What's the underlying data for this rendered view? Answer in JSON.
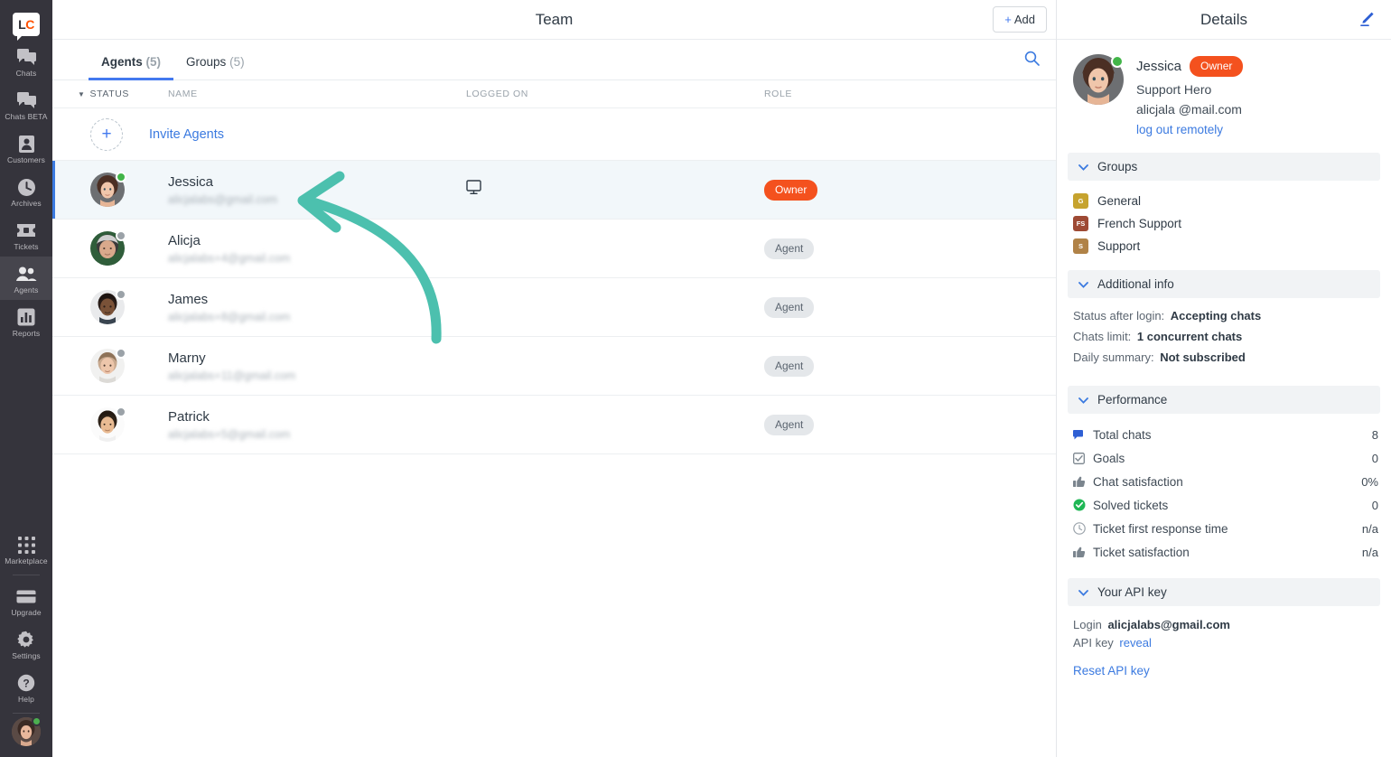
{
  "nav": {
    "logo": "LC",
    "items": [
      {
        "label": "Chats",
        "icon": "chats-icon",
        "active": false
      },
      {
        "label": "Chats BETA",
        "icon": "chats-beta-icon",
        "active": false
      },
      {
        "label": "Customers",
        "icon": "customers-icon",
        "active": false
      },
      {
        "label": "Archives",
        "icon": "archives-clock-icon",
        "active": false
      },
      {
        "label": "Tickets",
        "icon": "ticket-icon",
        "active": false
      },
      {
        "label": "Agents",
        "icon": "agents-people-icon",
        "active": true
      },
      {
        "label": "Reports",
        "icon": "reports-bars-icon",
        "active": false
      }
    ],
    "bottom_items": [
      {
        "label": "Marketplace",
        "icon": "marketplace-grid-icon"
      },
      {
        "label": "Upgrade",
        "icon": "upgrade-card-icon"
      },
      {
        "label": "Settings",
        "icon": "settings-gear-icon"
      },
      {
        "label": "Help",
        "icon": "help-question-icon"
      }
    ]
  },
  "header": {
    "title": "Team",
    "add_label": "Add",
    "add_plus": "+"
  },
  "tabs": [
    {
      "label": "Agents",
      "count": "(5)",
      "active": true
    },
    {
      "label": "Groups",
      "count": "(5)",
      "active": false
    }
  ],
  "list_header": {
    "status": "STATUS",
    "name": "NAME",
    "logged_on": "LOGGED ON",
    "role": "ROLE",
    "sort_caret": "▼"
  },
  "invite": {
    "label": "Invite Agents",
    "plus": "+"
  },
  "agents": [
    {
      "name": "Jessica",
      "email": "alicjalabs@gmail.com",
      "status": "online",
      "role": "Owner",
      "role_type": "owner",
      "logged_on": "desktop",
      "selected": true
    },
    {
      "name": "Alicja",
      "email": "alicjalabs+4@gmail.com",
      "status": "offline",
      "role": "Agent",
      "role_type": "agent",
      "logged_on": "",
      "selected": false
    },
    {
      "name": "James",
      "email": "alicjalabs+8@gmail.com",
      "status": "offline",
      "role": "Agent",
      "role_type": "agent",
      "logged_on": "",
      "selected": false
    },
    {
      "name": "Marny",
      "email": "alicjalabs+11@gmail.com",
      "status": "offline",
      "role": "Agent",
      "role_type": "agent",
      "logged_on": "",
      "selected": false
    },
    {
      "name": "Patrick",
      "email": "alicjalabs+5@gmail.com",
      "status": "offline",
      "role": "Agent",
      "role_type": "agent",
      "logged_on": "",
      "selected": false
    }
  ],
  "details": {
    "title": "Details",
    "profile": {
      "name": "Jessica",
      "badge": "Owner",
      "subtitle": "Support Hero",
      "email": "alicjala @mail.com",
      "logout_link": "log out remotely",
      "status": "online"
    },
    "groups_section": {
      "title": "Groups",
      "chevron": "⌄"
    },
    "groups": [
      {
        "initials": "G",
        "name": "General",
        "color": "#c6a32e"
      },
      {
        "initials": "FS",
        "name": "French Support",
        "color": "#9e4a34"
      },
      {
        "initials": "S",
        "name": "Support",
        "color": "#b08247"
      }
    ],
    "additional_section": {
      "title": "Additional info",
      "chevron": "⌄"
    },
    "additional": [
      {
        "label": "Status after login:",
        "value": "Accepting chats"
      },
      {
        "label": "Chats limit:",
        "value": "1 concurrent chats"
      },
      {
        "label": "Daily summary:",
        "value": "Not subscribed"
      }
    ],
    "performance_section": {
      "title": "Performance",
      "chevron": "⌄"
    },
    "performance": [
      {
        "icon": "chat-flag-icon",
        "label": "Total chats",
        "value": "8"
      },
      {
        "icon": "goals-checkbox-icon",
        "label": "Goals",
        "value": "0"
      },
      {
        "icon": "thumbs-up-icon",
        "label": "Chat satisfaction",
        "value": "0%"
      },
      {
        "icon": "solved-check-circle-icon",
        "label": "Solved tickets",
        "value": "0"
      },
      {
        "icon": "clock-icon",
        "label": "Ticket first response time",
        "value": "n/a"
      },
      {
        "icon": "thumbs-up-icon",
        "label": "Ticket satisfaction",
        "value": "n/a"
      }
    ],
    "api_section": {
      "title": "Your API key",
      "chevron": "⌄"
    },
    "api": {
      "login_label": "Login",
      "login_value": "alicjalabs@gmail.com",
      "key_label": "API key",
      "key_link": "reveal",
      "reset_label": "Reset API key"
    }
  },
  "annotation": {
    "type": "curved-arrow",
    "color": "#4cc0ae"
  },
  "colors": {
    "accent_blue": "#3b7ae0",
    "owner_orange": "#f4511e",
    "online_green": "#42b549",
    "nav_bg": "#35343c",
    "selected_row": "#f2f7fa"
  }
}
